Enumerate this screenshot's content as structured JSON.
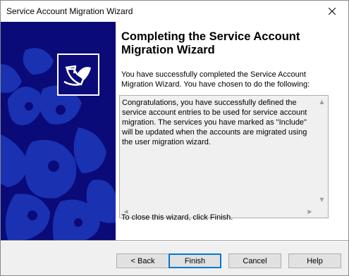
{
  "window": {
    "title": "Service Account Migration Wizard"
  },
  "icons": {
    "close": "close-icon",
    "logo": "wizard-logo-icon",
    "scroll_up": "scroll-up-icon",
    "scroll_down": "scroll-down-icon",
    "scroll_left": "scroll-left-icon",
    "scroll_right": "scroll-right-icon"
  },
  "colors": {
    "side_panel": "#0a0a78",
    "default_button_border": "#0078d7"
  },
  "content": {
    "heading": "Completing the Service Account Migration Wizard",
    "intro": "You have successfully completed the Service Account Migration Wizard.  You have chosen to do the following:",
    "summary": "Congratulations, you have successfully defined the service account entries to be used for service account migration.  The services you have marked as \"Include\" will be updated when the accounts are migrated using the user migration wizard.",
    "outro": "To close this wizard, click Finish."
  },
  "buttons": {
    "back": "< Back",
    "finish": "Finish",
    "cancel": "Cancel",
    "help": "Help"
  }
}
